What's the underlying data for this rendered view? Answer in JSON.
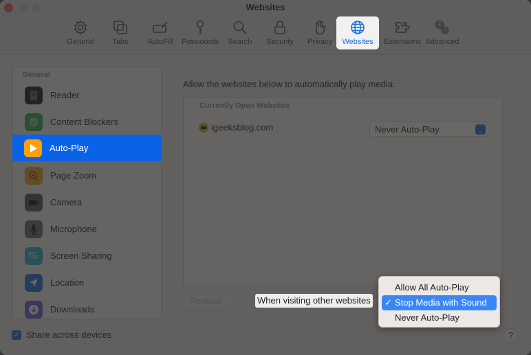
{
  "window": {
    "title": "Websites",
    "traffic_lights": [
      "close",
      "minimize",
      "zoom"
    ]
  },
  "toolbar": {
    "items": [
      {
        "label": "General",
        "icon": "gear-icon"
      },
      {
        "label": "Tabs",
        "icon": "tabs-icon"
      },
      {
        "label": "AutoFill",
        "icon": "autofill-icon"
      },
      {
        "label": "Passwords",
        "icon": "key-icon"
      },
      {
        "label": "Search",
        "icon": "magnifier-icon"
      },
      {
        "label": "Security",
        "icon": "lock-icon"
      },
      {
        "label": "Privacy",
        "icon": "hand-icon"
      },
      {
        "label": "Websites",
        "icon": "globe-icon",
        "active": true
      },
      {
        "label": "Extensions",
        "icon": "puzzle-icon"
      },
      {
        "label": "Advanced",
        "icon": "gears-icon"
      }
    ]
  },
  "sidebar": {
    "header": "General",
    "items": [
      {
        "label": "Reader",
        "icon": "reader-icon",
        "color": "#1c1c1c"
      },
      {
        "label": "Content Blockers",
        "icon": "shield-check-icon",
        "color": "#34a853"
      },
      {
        "label": "Auto-Play",
        "icon": "play-icon",
        "color": "#ff9f0a",
        "selected": true
      },
      {
        "label": "Page Zoom",
        "icon": "zoom-icon",
        "color": "#f0a020"
      },
      {
        "label": "Camera",
        "icon": "camera-icon",
        "color": "#555555"
      },
      {
        "label": "Microphone",
        "icon": "microphone-icon",
        "color": "#6b6b6b"
      },
      {
        "label": "Screen Sharing",
        "icon": "screen-sharing-icon",
        "color": "#2ab4d8"
      },
      {
        "label": "Location",
        "icon": "location-icon",
        "color": "#1e6fe0"
      },
      {
        "label": "Downloads",
        "icon": "download-icon",
        "color": "#6a5ae0"
      }
    ]
  },
  "main": {
    "description": "Allow the websites below to automatically play media:",
    "sites_header": "Currently Open Websites",
    "sites": [
      {
        "name": "igeeksblog.com",
        "setting": "Never Auto-Play"
      }
    ],
    "remove_label": "Remove",
    "other_websites_label": "When visiting other websites",
    "menu_options": [
      {
        "label": "Allow All Auto-Play",
        "checked": false
      },
      {
        "label": "Stop Media with Sound",
        "checked": true
      },
      {
        "label": "Never Auto-Play",
        "checked": false
      }
    ],
    "check_glyph": "✓"
  },
  "footer": {
    "share_label": "Share across devices",
    "share_checked": true,
    "help_label": "?"
  },
  "colors": {
    "accent": "#0a63e6",
    "menu_highlight": "#3b86f6"
  }
}
